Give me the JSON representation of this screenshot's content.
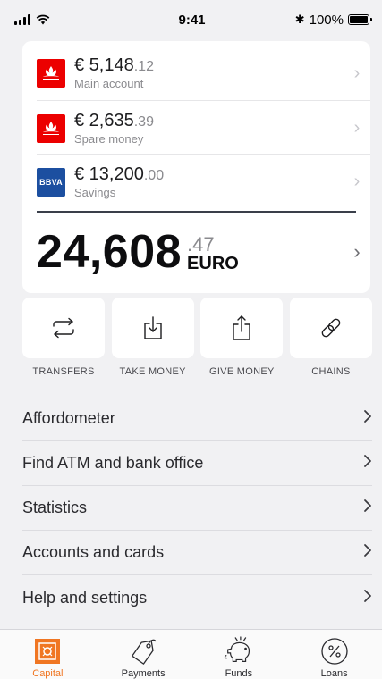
{
  "status_bar": {
    "time": "9:41",
    "battery": "100%",
    "bluetooth_glyph": "✱"
  },
  "accounts": [
    {
      "bank": "santander",
      "amount_main": "€ 5,148",
      "amount_cents": ".12",
      "name": "Main account"
    },
    {
      "bank": "santander",
      "amount_main": "€ 2,635",
      "amount_cents": ".39",
      "name": "Spare money"
    },
    {
      "bank": "bbva",
      "logo_text": "BBVA",
      "amount_main": "€ 13,200",
      "amount_cents": ".00",
      "name": "Savings"
    }
  ],
  "total": {
    "amount_main": "24,608",
    "amount_cents": ".47",
    "currency": "EURO"
  },
  "actions": [
    {
      "label": "TRANSFERS",
      "icon": "transfer-arrows-icon"
    },
    {
      "label": "TAKE MONEY",
      "icon": "tray-download-icon"
    },
    {
      "label": "GIVE MONEY",
      "icon": "share-upload-icon"
    },
    {
      "label": "CHAINS",
      "icon": "chain-link-icon"
    }
  ],
  "menu": [
    "Affordometer",
    "Find ATM and bank office",
    "Statistics",
    "Accounts and cards",
    "Help and settings"
  ],
  "tabs": [
    {
      "label": "Capital",
      "icon": "safe-icon",
      "active": true
    },
    {
      "label": "Payments",
      "icon": "tag-icon",
      "active": false
    },
    {
      "label": "Funds",
      "icon": "piggy-bank-icon",
      "active": false
    },
    {
      "label": "Loans",
      "icon": "percent-icon",
      "active": false
    }
  ],
  "colors": {
    "accent": "#f07622",
    "santander_red": "#ec0000",
    "bbva_blue": "#1c4fa0",
    "background": "#f1f1f3"
  }
}
